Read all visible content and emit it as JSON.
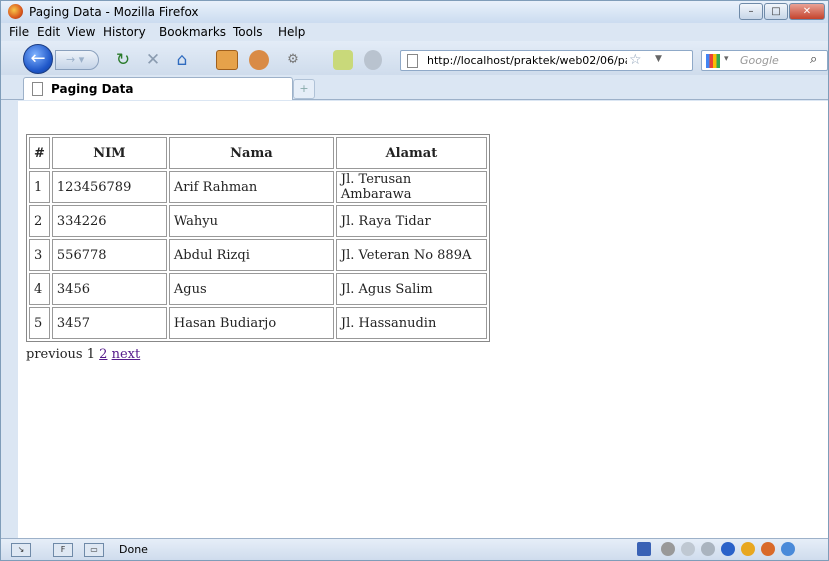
{
  "window": {
    "title": "Paging Data - Mozilla Firefox",
    "buttons": {
      "minimize": "–",
      "maximize": "□",
      "close": "✕"
    }
  },
  "menu": [
    "File",
    "Edit",
    "View",
    "History",
    "Bookmarks",
    "Tools",
    "Help"
  ],
  "nav": {
    "url": "http://localhost/praktek/web02/06/pag",
    "search_placeholder": "Google"
  },
  "tab": {
    "label": "Paging Data",
    "new_tab": "+"
  },
  "table": {
    "headers": [
      "#",
      "NIM",
      "Nama",
      "Alamat"
    ],
    "rows": [
      [
        "1",
        "123456789",
        "Arif Rahman",
        "Jl. Terusan Ambarawa"
      ],
      [
        "2",
        "334226",
        "Wahyu",
        "Jl. Raya Tidar"
      ],
      [
        "3",
        "556778",
        "Abdul Rizqi",
        "Jl. Veteran No 889A"
      ],
      [
        "4",
        "3456",
        "Agus",
        "Jl. Agus Salim"
      ],
      [
        "5",
        "3457",
        "Hasan Budiarjo",
        "Jl. Hassanudin"
      ]
    ]
  },
  "pager": {
    "previous": "previous",
    "current": "1",
    "page2": "2",
    "next": "next"
  },
  "status": {
    "text": "Done"
  },
  "colors": {
    "link_visited": "#551a8b",
    "chrome": "#dbe6f3"
  },
  "icons": [
    "firefox-logo-icon",
    "back-icon",
    "forward-icon",
    "reload-icon",
    "stop-icon",
    "home-icon",
    "star-icon",
    "search-icon"
  ]
}
